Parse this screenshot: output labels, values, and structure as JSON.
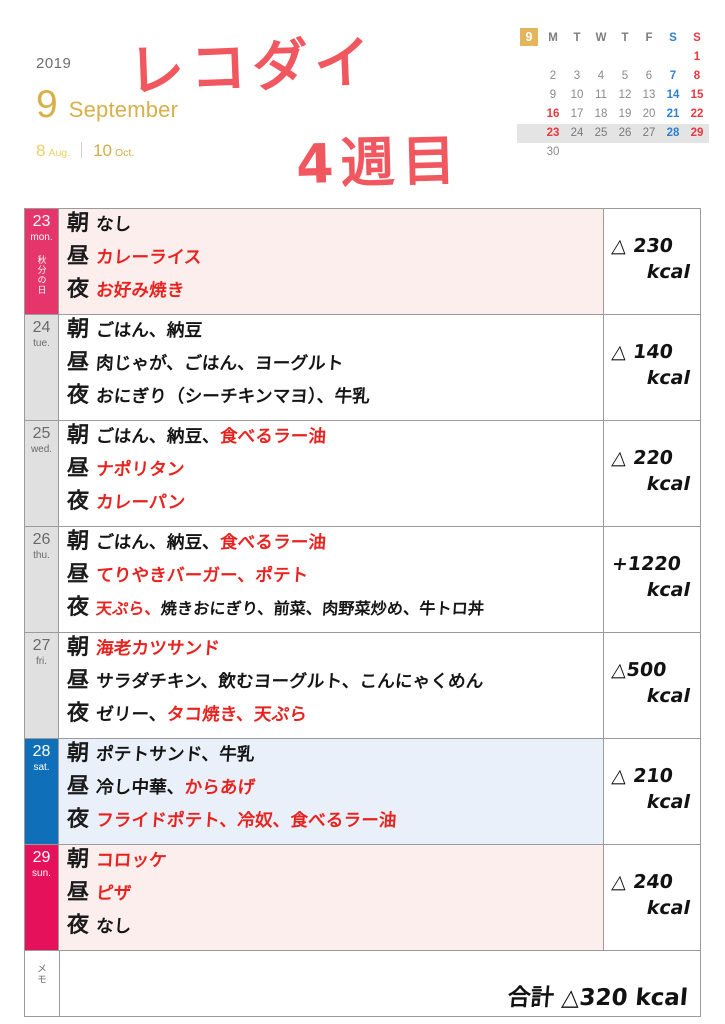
{
  "header": {
    "year": "2019",
    "month_number": "9",
    "month_name": "September",
    "prev_month_num": "8",
    "prev_month_abbr": "Aug.",
    "separator": "|",
    "next_month_num": "10",
    "next_month_abbr": "Oct.",
    "handwritten_title": "レコダイ",
    "handwritten_subtitle": "4週目",
    "accent_gold": "#d7b04a",
    "handwriting_red": "#f1575f"
  },
  "mini_calendar": {
    "month_badge": "9",
    "weekday_headers": [
      "M",
      "T",
      "W",
      "T",
      "F",
      "S",
      "S"
    ],
    "weeks": [
      [
        "",
        "",
        "",
        "",
        "",
        "",
        "1"
      ],
      [
        "2",
        "3",
        "4",
        "5",
        "6",
        "7",
        "8"
      ],
      [
        "9",
        "10",
        "11",
        "12",
        "13",
        "14",
        "15"
      ],
      [
        "16",
        "17",
        "18",
        "19",
        "20",
        "21",
        "22"
      ],
      [
        "23",
        "24",
        "25",
        "26",
        "27",
        "28",
        "29"
      ],
      [
        "30",
        "",
        "",
        "",
        "",
        "",
        ""
      ]
    ],
    "highlighted_week_index": 4,
    "holiday_dates": [
      "16",
      "23"
    ],
    "saturday_color": "#2f7fd0",
    "sunday_color": "#e8383f",
    "badge_color": "#e3b55c"
  },
  "table": {
    "meal_labels": {
      "morning": "朝",
      "noon": "昼",
      "night": "夜"
    },
    "kcal_unit": "kcal",
    "rows": [
      {
        "date": "23",
        "weekday": "mon.",
        "tab_style": "mon",
        "row_style": "r-mon",
        "holiday_label": "秋分の日",
        "meals": {
          "morning": [
            {
              "t": "なし",
              "c": "k"
            }
          ],
          "noon": [
            {
              "t": "カレーライス",
              "c": "r"
            }
          ],
          "night": [
            {
              "t": "お好み焼き",
              "c": "r"
            }
          ]
        },
        "kcal_value": "△ 230"
      },
      {
        "date": "24",
        "weekday": "tue.",
        "tab_style": "gray",
        "row_style": "",
        "holiday_label": "",
        "meals": {
          "morning": [
            {
              "t": "ごはん、納豆",
              "c": "k"
            }
          ],
          "noon": [
            {
              "t": "肉じゃが、ごはん、ヨーグルト",
              "c": "k"
            }
          ],
          "night": [
            {
              "t": "おにぎり（シーチキンマヨ）、牛乳",
              "c": "k"
            }
          ]
        },
        "kcal_value": "△ 140"
      },
      {
        "date": "25",
        "weekday": "wed.",
        "tab_style": "gray",
        "row_style": "",
        "holiday_label": "",
        "meals": {
          "morning": [
            {
              "t": "ごはん、納豆、",
              "c": "k"
            },
            {
              "t": "食べるラー油",
              "c": "r"
            }
          ],
          "noon": [
            {
              "t": "ナポリタン",
              "c": "r"
            }
          ],
          "night": [
            {
              "t": "カレーパン",
              "c": "r"
            }
          ]
        },
        "kcal_value": "△ 220"
      },
      {
        "date": "26",
        "weekday": "thu.",
        "tab_style": "gray",
        "row_style": "",
        "holiday_label": "",
        "meals": {
          "morning": [
            {
              "t": "ごはん、納豆、",
              "c": "k"
            },
            {
              "t": "食べるラー油",
              "c": "r"
            }
          ],
          "noon": [
            {
              "t": "てりやきバーガー、ポテト",
              "c": "r"
            }
          ],
          "night": [
            {
              "t": "天ぷら、",
              "c": "r"
            },
            {
              "t": "焼きおにぎり、前菜、肉野菜炒め、牛トロ丼",
              "c": "k"
            }
          ]
        },
        "kcal_value": "+1220"
      },
      {
        "date": "27",
        "weekday": "fri.",
        "tab_style": "gray",
        "row_style": "",
        "holiday_label": "",
        "meals": {
          "morning": [
            {
              "t": "海老カツサンド",
              "c": "r"
            }
          ],
          "noon": [
            {
              "t": "サラダチキン、飲むヨーグルト、こんにゃくめん",
              "c": "k"
            }
          ],
          "night": [
            {
              "t": "ゼリー、",
              "c": "k"
            },
            {
              "t": "タコ焼き、天ぷら",
              "c": "r"
            }
          ]
        },
        "kcal_value": "△500"
      },
      {
        "date": "28",
        "weekday": "sat.",
        "tab_style": "sat",
        "row_style": "r-sat",
        "holiday_label": "",
        "meals": {
          "morning": [
            {
              "t": "ポテトサンド、牛乳",
              "c": "k"
            }
          ],
          "noon": [
            {
              "t": "冷し中華、",
              "c": "k"
            },
            {
              "t": "からあげ",
              "c": "r"
            }
          ],
          "night": [
            {
              "t": "フライドポテト、冷奴、食べるラー油",
              "c": "r"
            }
          ]
        },
        "kcal_value": "△ 210"
      },
      {
        "date": "29",
        "weekday": "sun.",
        "tab_style": "sun",
        "row_style": "r-sun",
        "holiday_label": "",
        "meals": {
          "morning": [
            {
              "t": "コロッケ",
              "c": "r"
            }
          ],
          "noon": [
            {
              "t": "ピザ",
              "c": "r"
            }
          ],
          "night": [
            {
              "t": "なし",
              "c": "k"
            }
          ]
        },
        "kcal_value": "△ 240"
      }
    ]
  },
  "memo": {
    "label": "メモ",
    "total_text": "合計 △320 kcal"
  }
}
